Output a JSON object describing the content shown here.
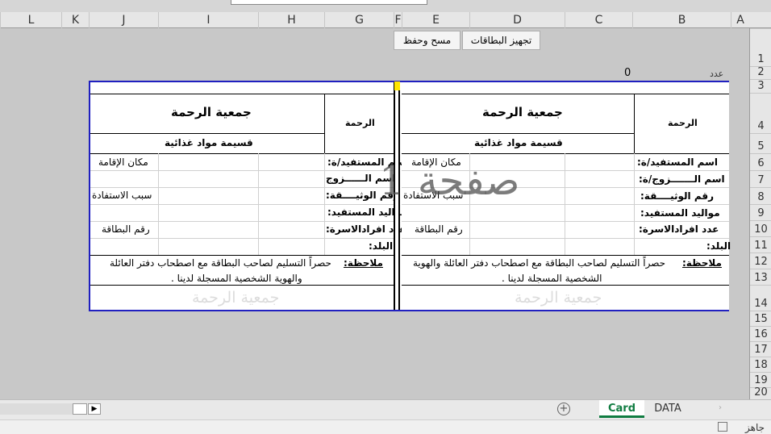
{
  "columns": [
    "L",
    "K",
    "J",
    "I",
    "H",
    "G",
    "F",
    "E",
    "D",
    "C",
    "B",
    "A"
  ],
  "rows": [
    "1",
    "2",
    "3",
    "4",
    "5",
    "6",
    "7",
    "8",
    "9",
    "10",
    "11",
    "12",
    "13",
    "14",
    "15",
    "16",
    "17",
    "18",
    "19",
    "20"
  ],
  "buttons": {
    "prepare_cards": "تجهيز البطاقات",
    "clear_save": "مسح وحفظ"
  },
  "count": {
    "label": "عدد",
    "value": "0"
  },
  "card": {
    "org_name": "جمعية الرحمة",
    "short_name": "الرحمة",
    "subtitle": "قسيمة مواد غذائية",
    "fields": {
      "beneficiary": "اسم المستفيد/ة:",
      "spouse": "اسم الـــــــزوج/ة:",
      "doc_no": "رقم الوثيــــقة:",
      "birth": "مواليد المستفيد:",
      "family": "عدد افرادالاسرة:",
      "town": "البلد:",
      "residence": "مكان الإقامة",
      "reason": "سبب الاستفادة",
      "card_no": "رقم البطاقة",
      "spouse_short": "اسم الــــــزوج",
      "doc_short": "رقم الوثيــــقة:"
    },
    "note_label": "ملاحظة:",
    "note_line1_left": "حصراً التسليم لصاحب البطاقة مع اصطحاب دفتر العائلة",
    "note_line2_left": "والهوية الشخصية المسجلة لدينا .",
    "note_line1_right": "حصراً التسليم لصاحب البطاقة مع اصطحاب دفتر العائلة والهوية",
    "note_line2_right": "الشخصية المسجلة لدينا .",
    "footer_watermark": "جمعية الرحمة"
  },
  "page_watermark": "صفحة 1",
  "sheets": {
    "active": "Card",
    "other": "DATA"
  },
  "status": {
    "ready": "جاهز"
  },
  "colors": {
    "card_border": "#2020c0",
    "active_tab": "#107c41",
    "highlight": "#ffe600"
  }
}
